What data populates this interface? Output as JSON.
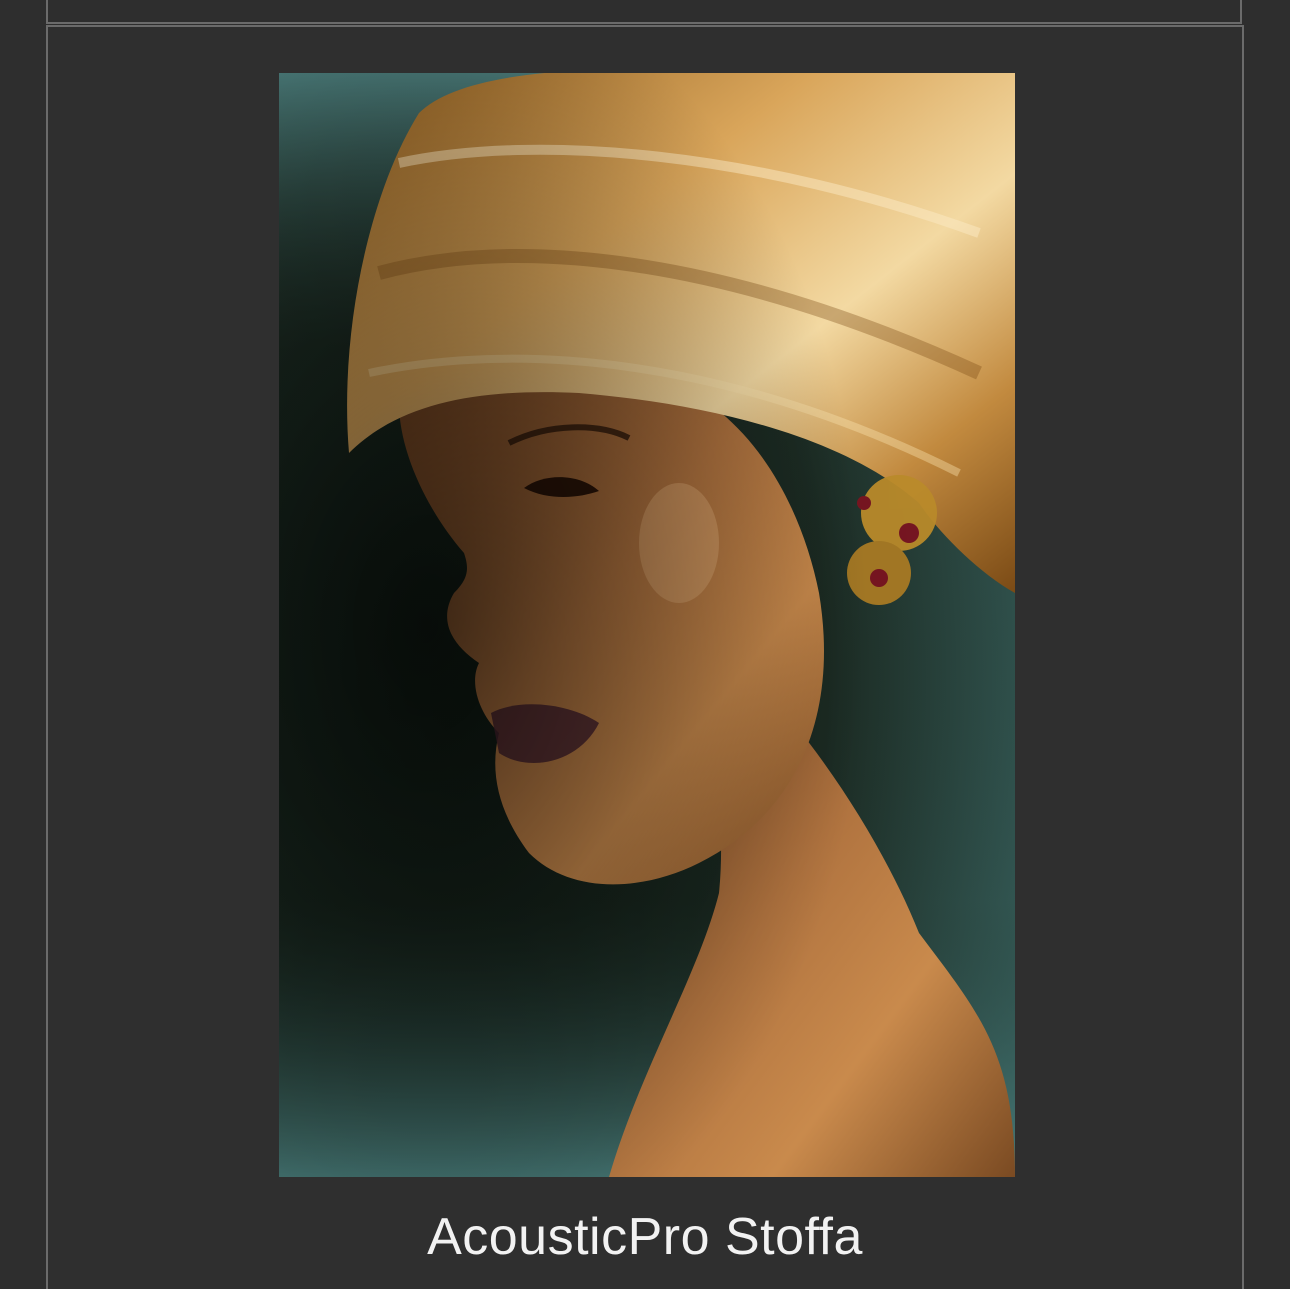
{
  "product": {
    "title": "AcousticPro Stoffa",
    "image_alt": "Portrait of a woman wearing a gold satin head wrap and ornate jeweled earring"
  },
  "colors": {
    "background": "#2e2e2e",
    "card_border": "#6b6b6b",
    "title_text": "#f2f2f2"
  }
}
